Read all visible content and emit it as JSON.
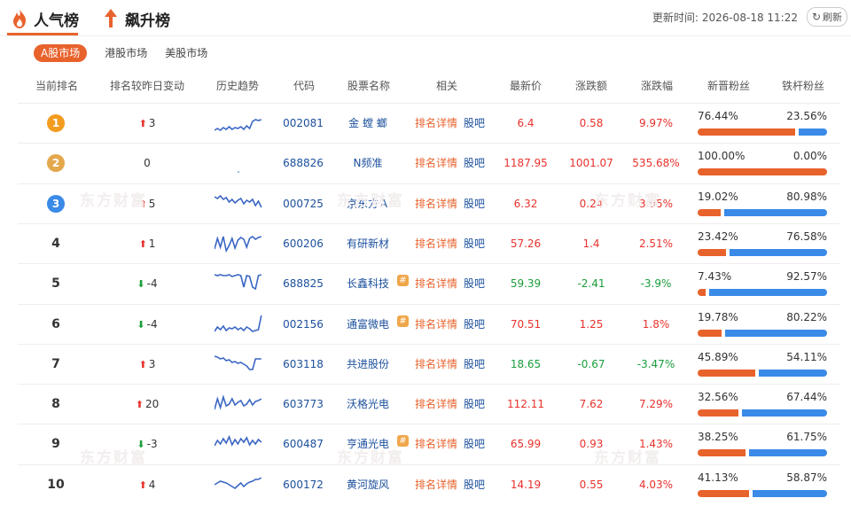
{
  "tabs": [
    {
      "label": "人气榜",
      "active": true
    },
    {
      "label": "飙升榜",
      "active": false
    }
  ],
  "update_label": "更新时间:",
  "update_time": "2026-08-18 11:22",
  "refresh_label": "刷新",
  "markets": [
    {
      "label": "A股市场",
      "active": true
    },
    {
      "label": "港股市场",
      "active": false
    },
    {
      "label": "美股市场",
      "active": false
    }
  ],
  "headers": {
    "rank": "当前排名",
    "change": "排名较昨日变动",
    "trend": "历史趋势",
    "code": "代码",
    "name": "股票名称",
    "related": "相关",
    "price": "最新价",
    "chg": "涨跌额",
    "pct": "涨跌幅",
    "new_fans": "新晋粉丝",
    "core_fans": "铁杆粉丝"
  },
  "related_links": {
    "detail": "排名详情",
    "bar": "股吧"
  },
  "watermark": "东方财富",
  "colors": {
    "accent": "#e8622c",
    "up": "#e8322c",
    "down": "#1a9d3a",
    "bar_new": "#e8622c",
    "bar_core": "#3a8ae8"
  },
  "rows": [
    {
      "rank": "1",
      "medal": "gold",
      "dir": "up",
      "change": "3",
      "code": "002081",
      "name": "金 螳 螂",
      "hot": false,
      "price": "6.4",
      "chg": "0.58",
      "pct": "9.97%",
      "color": "red",
      "new_fans": "76.44%",
      "core_fans": "23.56%",
      "new_frac": 0.7644
    },
    {
      "rank": "2",
      "medal": "silver",
      "dir": "none",
      "change": "0",
      "code": "688826",
      "name": "N频准",
      "hot": false,
      "price": "1187.95",
      "chg": "1001.07",
      "pct": "535.68%",
      "color": "red",
      "new_fans": "100.00%",
      "core_fans": "0.00%",
      "new_frac": 1.0
    },
    {
      "rank": "3",
      "medal": "bronze",
      "dir": "up",
      "change": "5",
      "code": "000725",
      "name": "京东方Ａ",
      "hot": false,
      "price": "6.32",
      "chg": "0.24",
      "pct": "3.95%",
      "color": "red",
      "new_fans": "19.02%",
      "core_fans": "80.98%",
      "new_frac": 0.1902
    },
    {
      "rank": "4",
      "medal": "",
      "dir": "up",
      "change": "1",
      "code": "600206",
      "name": "有研新材",
      "hot": false,
      "price": "57.26",
      "chg": "1.4",
      "pct": "2.51%",
      "color": "red",
      "new_fans": "23.42%",
      "core_fans": "76.58%",
      "new_frac": 0.2342
    },
    {
      "rank": "5",
      "medal": "",
      "dir": "down",
      "change": "-4",
      "code": "688825",
      "name": "长鑫科技",
      "hot": true,
      "price": "59.39",
      "chg": "-2.41",
      "pct": "-3.9%",
      "color": "green",
      "new_fans": "7.43%",
      "core_fans": "92.57%",
      "new_frac": 0.0743
    },
    {
      "rank": "6",
      "medal": "",
      "dir": "down",
      "change": "-4",
      "code": "002156",
      "name": "通富微电",
      "hot": true,
      "price": "70.51",
      "chg": "1.25",
      "pct": "1.8%",
      "color": "red",
      "new_fans": "19.78%",
      "core_fans": "80.22%",
      "new_frac": 0.1978
    },
    {
      "rank": "7",
      "medal": "",
      "dir": "up",
      "change": "3",
      "code": "603118",
      "name": "共进股份",
      "hot": false,
      "price": "18.65",
      "chg": "-0.67",
      "pct": "-3.47%",
      "color": "green",
      "new_fans": "45.89%",
      "core_fans": "54.11%",
      "new_frac": 0.4589
    },
    {
      "rank": "8",
      "medal": "",
      "dir": "up",
      "change": "20",
      "code": "603773",
      "name": "沃格光电",
      "hot": false,
      "price": "112.11",
      "chg": "7.62",
      "pct": "7.29%",
      "color": "red",
      "new_fans": "32.56%",
      "core_fans": "67.44%",
      "new_frac": 0.3256
    },
    {
      "rank": "9",
      "medal": "",
      "dir": "down",
      "change": "-3",
      "code": "600487",
      "name": "亨通光电",
      "hot": true,
      "price": "65.99",
      "chg": "0.93",
      "pct": "1.43%",
      "color": "red",
      "new_fans": "38.25%",
      "core_fans": "61.75%",
      "new_frac": 0.3825
    },
    {
      "rank": "10",
      "medal": "",
      "dir": "up",
      "change": "4",
      "code": "600172",
      "name": "黄河旋风",
      "hot": false,
      "price": "14.19",
      "chg": "0.55",
      "pct": "4.03%",
      "color": "red",
      "new_fans": "41.13%",
      "core_fans": "58.87%",
      "new_frac": 0.4113
    }
  ]
}
